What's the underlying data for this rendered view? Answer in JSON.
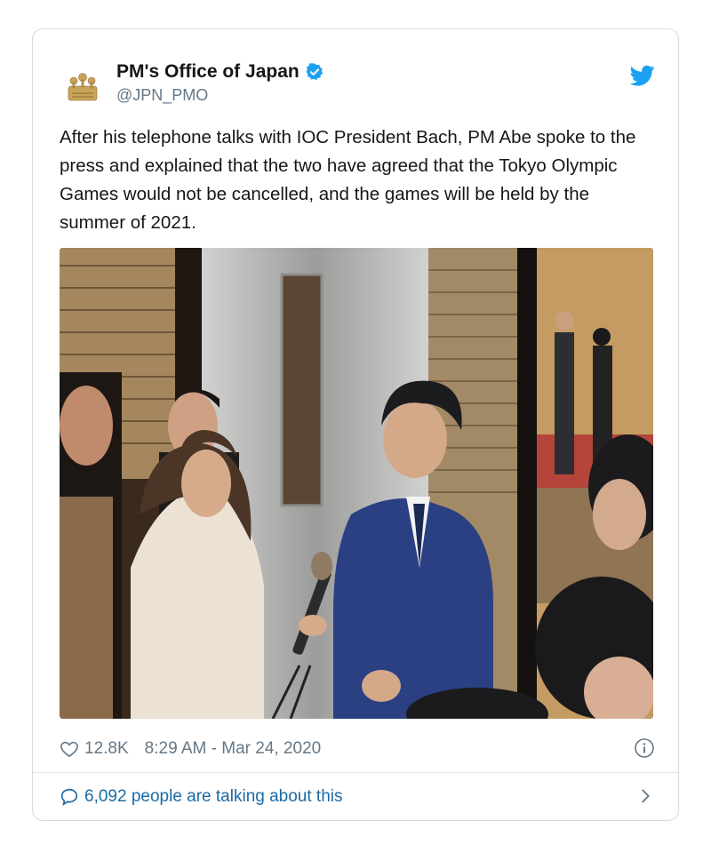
{
  "account": {
    "display_name": "PM's Office of Japan",
    "handle": "@JPN_PMO",
    "verified": true
  },
  "tweet": {
    "text": "After his telephone talks with IOC President Bach, PM Abe spoke to the press and explained that the two have agreed that the Tokyo Olympic Games would not be cancelled, and the games will be held by the summer of 2021."
  },
  "meta": {
    "likes": "12.8K",
    "timestamp": "8:29 AM - Mar 24, 2020"
  },
  "footer": {
    "talking": "6,092 people are talking about this"
  },
  "colors": {
    "brand_blue": "#1da1f2",
    "link_blue": "#1b6aa5",
    "text": "#14171a",
    "muted": "#657786"
  },
  "icons": [
    "government-seal-icon",
    "verified-badge-icon",
    "twitter-bird-icon",
    "heart-icon",
    "info-icon",
    "comment-bubble-icon",
    "chevron-right-icon"
  ]
}
